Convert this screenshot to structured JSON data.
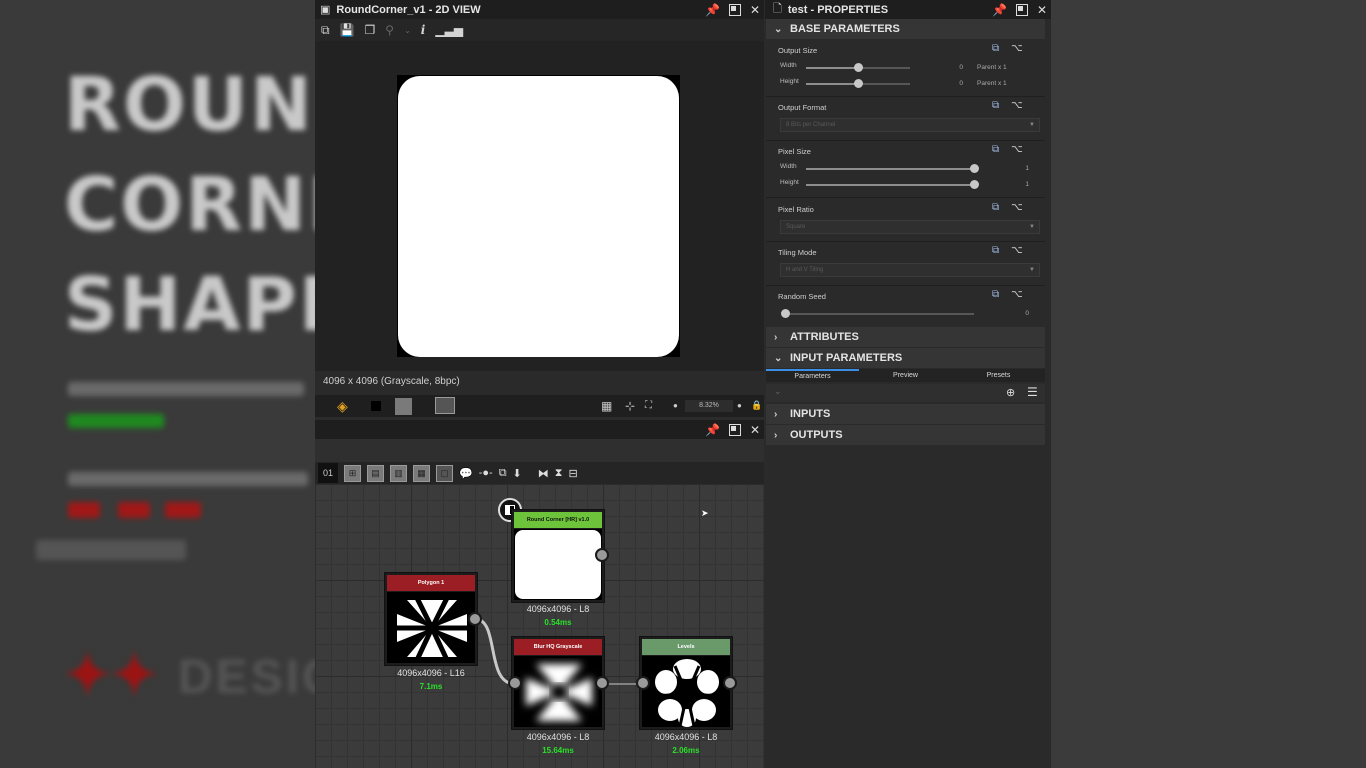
{
  "backdrop": {
    "title_lines": [
      "ROUNI",
      "CORNE",
      "SHAPE"
    ],
    "logo_text": "DESIG"
  },
  "view2d": {
    "title": "RoundCorner_v1 - 2D VIEW",
    "info": "4096 x 4096 (Grayscale, 8bpc)",
    "zoom": "8.32%"
  },
  "graph": {
    "toolbar_badge": "01",
    "nodes": [
      {
        "header": "Round Corner [HR] v1.0",
        "header_color": "#6dc43a",
        "resolution": "4096x4096 - L8",
        "timing": "0.54ms"
      },
      {
        "header": "Polygon 1",
        "header_color": "#9b1e24",
        "resolution": "4096x4096 - L16",
        "timing": "7.1ms"
      },
      {
        "header": "Blur HQ Grayscale",
        "header_color": "#9b1e24",
        "resolution": "4096x4096 - L8",
        "timing": "15.64ms"
      },
      {
        "header": "Levels",
        "header_color": "#6a9a6a",
        "resolution": "4096x4096 - L8",
        "timing": "2.06ms"
      }
    ]
  },
  "properties": {
    "title": "test - PROPERTIES",
    "base_parameters": "BASE PARAMETERS",
    "output_size": {
      "label": "Output Size",
      "width_label": "Width",
      "width_value": "0",
      "width_suffix": "Parent x 1",
      "height_label": "Height",
      "height_value": "0",
      "height_suffix": "Parent x 1",
      "fraction": 0.5
    },
    "output_format": {
      "label": "Output Format",
      "value": "8 Bits per Channel"
    },
    "pixel_size": {
      "label": "Pixel Size",
      "width_label": "Width",
      "width_value": "1",
      "height_label": "Height",
      "height_value": "1"
    },
    "pixel_ratio": {
      "label": "Pixel Ratio",
      "value": "Square"
    },
    "tiling_mode": {
      "label": "Tiling Mode",
      "value": "H and V Tiling"
    },
    "random_seed": {
      "label": "Random Seed",
      "value": "0"
    },
    "attributes": "ATTRIBUTES",
    "input_parameters": "INPUT PARAMETERS",
    "tabs": [
      "Parameters",
      "Preview",
      "Presets"
    ],
    "inputs": "INPUTS",
    "outputs": "OUTPUTS"
  },
  "icons": {
    "pin": "pin-icon",
    "maximize": "maximize-icon",
    "close": "close-icon"
  }
}
